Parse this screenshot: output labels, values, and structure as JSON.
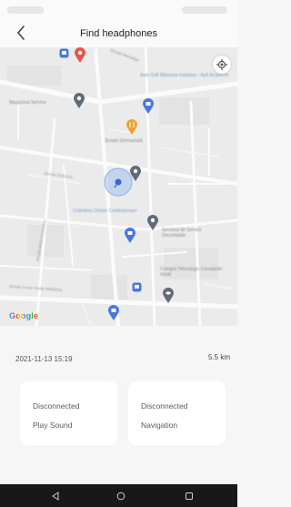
{
  "header": {
    "title": "Find headphones"
  },
  "map": {
    "attribution": "Google",
    "streets": [
      "Strada Mamaliga",
      "Strada Slobozia",
      "Strada Anina Vasile Mărăcine",
      "Strada Mihai Eminescu"
    ],
    "labels": [
      "Auto Soft Băneasa Instalare - Apă Acoperire",
      "Magazinul Service",
      "Școala Gimnazială",
      "Colegiul Tehnologic Constantin Istrati",
      "Colentina Chimie Confecționare",
      "Serviciul de Servicii Decontabile"
    ],
    "brand_colors": {
      "pin_blue": "#4a76e0",
      "pin_gray": "#5f6b78",
      "pin_red": "#e5534b",
      "pin_orange": "#f0a030"
    }
  },
  "info": {
    "timestamp": "2021-11-13 15:19",
    "distance": "5.5 km"
  },
  "cards": [
    {
      "status": "Disconnected",
      "action": "Play Sound"
    },
    {
      "status": "Disconnected",
      "action": "Navigation"
    }
  ],
  "icons": [
    "back-arrow-icon",
    "my-location-icon",
    "nav-back-icon",
    "nav-home-icon",
    "nav-recents-icon"
  ]
}
